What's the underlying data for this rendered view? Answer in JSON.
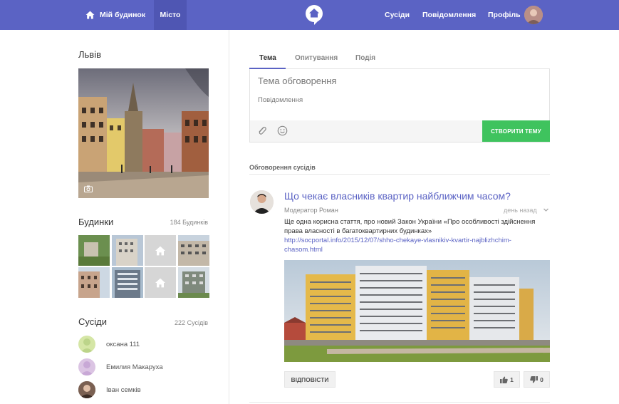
{
  "colors": {
    "brand": "#5b63c4",
    "brand_dark": "#4f56b3",
    "success": "#3fc35e"
  },
  "nav": {
    "my_house": "Мій будинок",
    "city": "Місто",
    "neighbors": "Сусіди",
    "messages": "Повідомлення",
    "profile": "Профіль"
  },
  "sidebar": {
    "city_name": "Львів",
    "buildings": {
      "title": "Будинки",
      "count": "184 Будинків"
    },
    "neighbors": {
      "title": "Сусіди",
      "count": "222 Сусідів",
      "items": [
        {
          "name": "оксана 111"
        },
        {
          "name": "Емилия Макаруха"
        },
        {
          "name": "Іван семків"
        }
      ]
    }
  },
  "composer": {
    "tabs": [
      "Тема",
      "Опитування",
      "Подія"
    ],
    "active_tab": "Тема",
    "topic_placeholder": "Тема обговорення",
    "message_placeholder": "Повідомлення",
    "create_button": "СТВОРИТИ ТЕМУ"
  },
  "feed": {
    "title": "Обговорення сусідів",
    "post": {
      "title": "Що чекає власників квартир найближчим часом?",
      "author": "Модератор Роман",
      "time": "день назад",
      "text": "Ще одна корисна стаття, про новий Закон України «Про особливості здійснення права власності в багатоквартирних будинках»",
      "link": "http://socportal.info/2015/12/07/shho-chekaye-vlasnikiv-kvartir-najblizhchim-chasom.html",
      "reply_button": "ВІДПОВІСТИ",
      "likes": "1",
      "dislikes": "0"
    }
  }
}
